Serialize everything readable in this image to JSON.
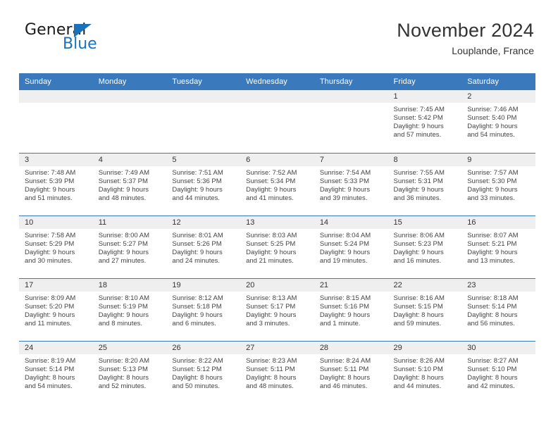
{
  "brand": {
    "name_top": "General",
    "name_bottom": "Blue",
    "triangle_color": "#1a72ba",
    "text_color": "#1a1a1a"
  },
  "header": {
    "title": "November 2024",
    "subtitle": "Louplande, France"
  },
  "theme": {
    "header_blue": "#3b79bd",
    "day_band_gray": "#efefef",
    "text": "#333333"
  },
  "calendar": {
    "weekday_headers": [
      "Sunday",
      "Monday",
      "Tuesday",
      "Wednesday",
      "Thursday",
      "Friday",
      "Saturday"
    ],
    "weeks": [
      [
        {
          "day": "",
          "empty": true
        },
        {
          "day": "",
          "empty": true
        },
        {
          "day": "",
          "empty": true
        },
        {
          "day": "",
          "empty": true
        },
        {
          "day": "",
          "empty": true
        },
        {
          "day": "1",
          "sunrise": "Sunrise: 7:45 AM",
          "sunset": "Sunset: 5:42 PM",
          "daylight1": "Daylight: 9 hours",
          "daylight2": "and 57 minutes."
        },
        {
          "day": "2",
          "sunrise": "Sunrise: 7:46 AM",
          "sunset": "Sunset: 5:40 PM",
          "daylight1": "Daylight: 9 hours",
          "daylight2": "and 54 minutes."
        }
      ],
      [
        {
          "day": "3",
          "sunrise": "Sunrise: 7:48 AM",
          "sunset": "Sunset: 5:39 PM",
          "daylight1": "Daylight: 9 hours",
          "daylight2": "and 51 minutes."
        },
        {
          "day": "4",
          "sunrise": "Sunrise: 7:49 AM",
          "sunset": "Sunset: 5:37 PM",
          "daylight1": "Daylight: 9 hours",
          "daylight2": "and 48 minutes."
        },
        {
          "day": "5",
          "sunrise": "Sunrise: 7:51 AM",
          "sunset": "Sunset: 5:36 PM",
          "daylight1": "Daylight: 9 hours",
          "daylight2": "and 44 minutes."
        },
        {
          "day": "6",
          "sunrise": "Sunrise: 7:52 AM",
          "sunset": "Sunset: 5:34 PM",
          "daylight1": "Daylight: 9 hours",
          "daylight2": "and 41 minutes."
        },
        {
          "day": "7",
          "sunrise": "Sunrise: 7:54 AM",
          "sunset": "Sunset: 5:33 PM",
          "daylight1": "Daylight: 9 hours",
          "daylight2": "and 39 minutes."
        },
        {
          "day": "8",
          "sunrise": "Sunrise: 7:55 AM",
          "sunset": "Sunset: 5:31 PM",
          "daylight1": "Daylight: 9 hours",
          "daylight2": "and 36 minutes."
        },
        {
          "day": "9",
          "sunrise": "Sunrise: 7:57 AM",
          "sunset": "Sunset: 5:30 PM",
          "daylight1": "Daylight: 9 hours",
          "daylight2": "and 33 minutes."
        }
      ],
      [
        {
          "day": "10",
          "sunrise": "Sunrise: 7:58 AM",
          "sunset": "Sunset: 5:29 PM",
          "daylight1": "Daylight: 9 hours",
          "daylight2": "and 30 minutes."
        },
        {
          "day": "11",
          "sunrise": "Sunrise: 8:00 AM",
          "sunset": "Sunset: 5:27 PM",
          "daylight1": "Daylight: 9 hours",
          "daylight2": "and 27 minutes."
        },
        {
          "day": "12",
          "sunrise": "Sunrise: 8:01 AM",
          "sunset": "Sunset: 5:26 PM",
          "daylight1": "Daylight: 9 hours",
          "daylight2": "and 24 minutes."
        },
        {
          "day": "13",
          "sunrise": "Sunrise: 8:03 AM",
          "sunset": "Sunset: 5:25 PM",
          "daylight1": "Daylight: 9 hours",
          "daylight2": "and 21 minutes."
        },
        {
          "day": "14",
          "sunrise": "Sunrise: 8:04 AM",
          "sunset": "Sunset: 5:24 PM",
          "daylight1": "Daylight: 9 hours",
          "daylight2": "and 19 minutes."
        },
        {
          "day": "15",
          "sunrise": "Sunrise: 8:06 AM",
          "sunset": "Sunset: 5:23 PM",
          "daylight1": "Daylight: 9 hours",
          "daylight2": "and 16 minutes."
        },
        {
          "day": "16",
          "sunrise": "Sunrise: 8:07 AM",
          "sunset": "Sunset: 5:21 PM",
          "daylight1": "Daylight: 9 hours",
          "daylight2": "and 13 minutes."
        }
      ],
      [
        {
          "day": "17",
          "sunrise": "Sunrise: 8:09 AM",
          "sunset": "Sunset: 5:20 PM",
          "daylight1": "Daylight: 9 hours",
          "daylight2": "and 11 minutes."
        },
        {
          "day": "18",
          "sunrise": "Sunrise: 8:10 AM",
          "sunset": "Sunset: 5:19 PM",
          "daylight1": "Daylight: 9 hours",
          "daylight2": "and 8 minutes."
        },
        {
          "day": "19",
          "sunrise": "Sunrise: 8:12 AM",
          "sunset": "Sunset: 5:18 PM",
          "daylight1": "Daylight: 9 hours",
          "daylight2": "and 6 minutes."
        },
        {
          "day": "20",
          "sunrise": "Sunrise: 8:13 AM",
          "sunset": "Sunset: 5:17 PM",
          "daylight1": "Daylight: 9 hours",
          "daylight2": "and 3 minutes."
        },
        {
          "day": "21",
          "sunrise": "Sunrise: 8:15 AM",
          "sunset": "Sunset: 5:16 PM",
          "daylight1": "Daylight: 9 hours",
          "daylight2": "and 1 minute."
        },
        {
          "day": "22",
          "sunrise": "Sunrise: 8:16 AM",
          "sunset": "Sunset: 5:15 PM",
          "daylight1": "Daylight: 8 hours",
          "daylight2": "and 59 minutes."
        },
        {
          "day": "23",
          "sunrise": "Sunrise: 8:18 AM",
          "sunset": "Sunset: 5:14 PM",
          "daylight1": "Daylight: 8 hours",
          "daylight2": "and 56 minutes."
        }
      ],
      [
        {
          "day": "24",
          "sunrise": "Sunrise: 8:19 AM",
          "sunset": "Sunset: 5:14 PM",
          "daylight1": "Daylight: 8 hours",
          "daylight2": "and 54 minutes."
        },
        {
          "day": "25",
          "sunrise": "Sunrise: 8:20 AM",
          "sunset": "Sunset: 5:13 PM",
          "daylight1": "Daylight: 8 hours",
          "daylight2": "and 52 minutes."
        },
        {
          "day": "26",
          "sunrise": "Sunrise: 8:22 AM",
          "sunset": "Sunset: 5:12 PM",
          "daylight1": "Daylight: 8 hours",
          "daylight2": "and 50 minutes."
        },
        {
          "day": "27",
          "sunrise": "Sunrise: 8:23 AM",
          "sunset": "Sunset: 5:11 PM",
          "daylight1": "Daylight: 8 hours",
          "daylight2": "and 48 minutes."
        },
        {
          "day": "28",
          "sunrise": "Sunrise: 8:24 AM",
          "sunset": "Sunset: 5:11 PM",
          "daylight1": "Daylight: 8 hours",
          "daylight2": "and 46 minutes."
        },
        {
          "day": "29",
          "sunrise": "Sunrise: 8:26 AM",
          "sunset": "Sunset: 5:10 PM",
          "daylight1": "Daylight: 8 hours",
          "daylight2": "and 44 minutes."
        },
        {
          "day": "30",
          "sunrise": "Sunrise: 8:27 AM",
          "sunset": "Sunset: 5:10 PM",
          "daylight1": "Daylight: 8 hours",
          "daylight2": "and 42 minutes."
        }
      ]
    ]
  }
}
